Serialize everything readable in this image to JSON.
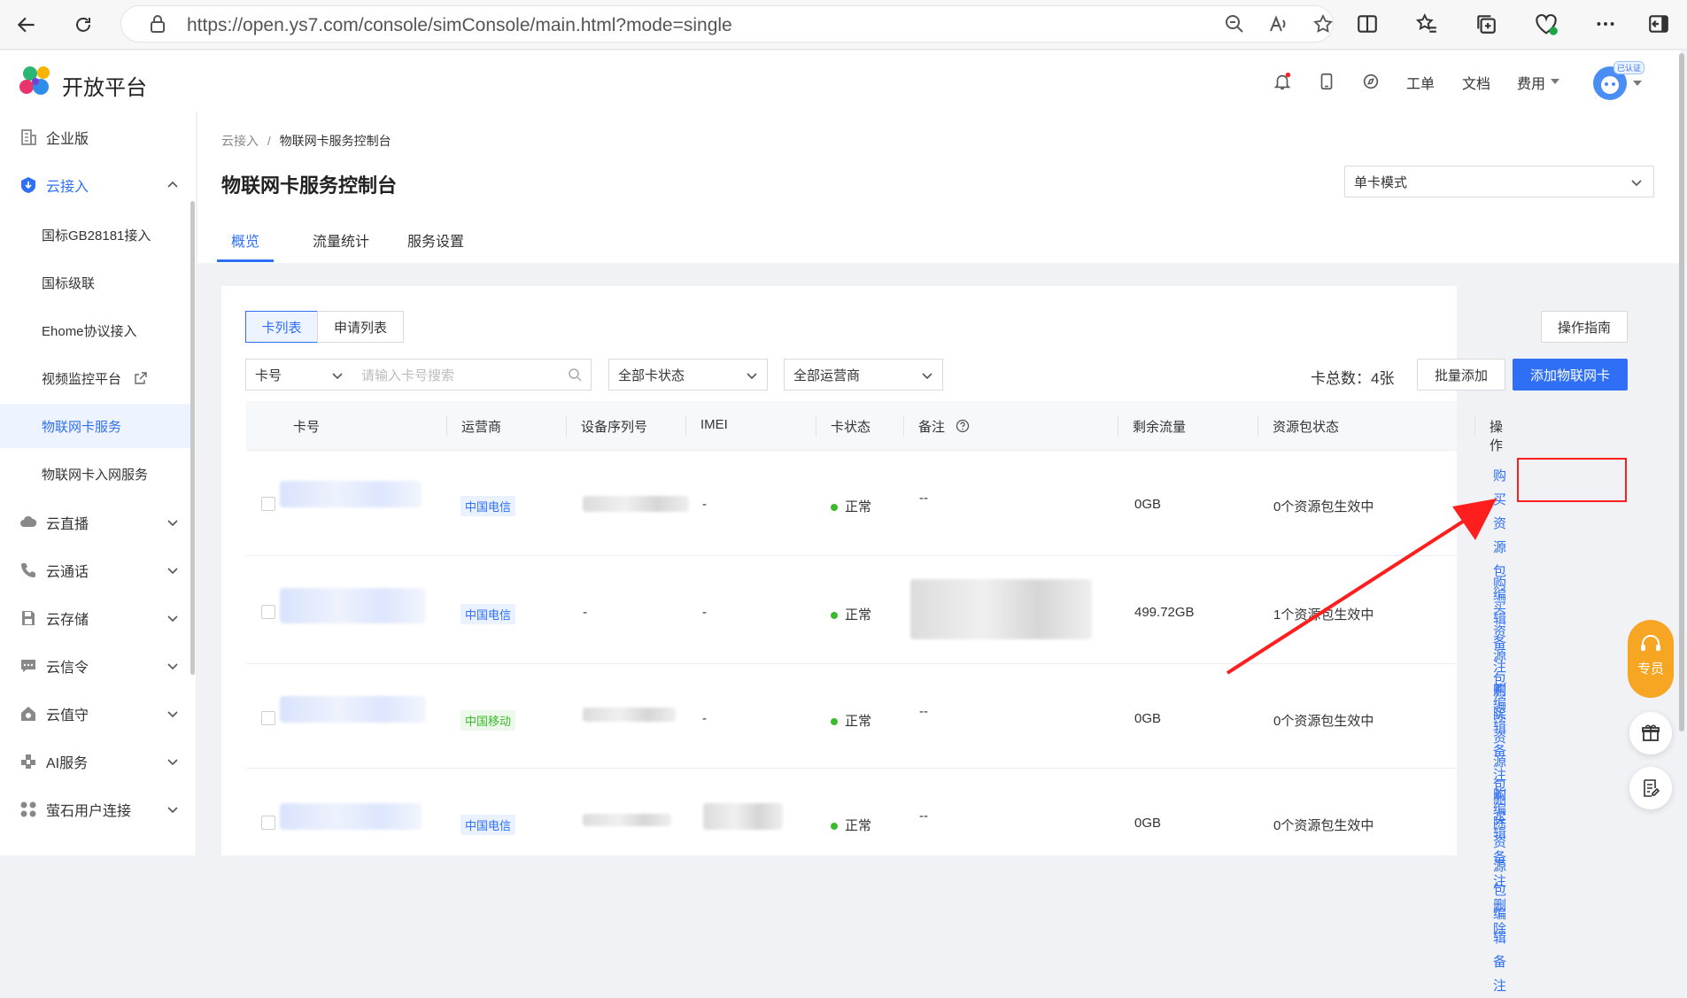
{
  "browser": {
    "url": "https://open.ys7.com/console/simConsole/main.html?mode=single"
  },
  "header": {
    "logo_text": "开放平台",
    "links": {
      "ticket": "工单",
      "docs": "文档",
      "fees": "费用"
    },
    "verified_badge": "已认证"
  },
  "sidebar": {
    "items": [
      {
        "label": "企业版",
        "icon": "building-icon"
      },
      {
        "label": "云接入",
        "icon": "cloud-access-icon"
      },
      {
        "label": "国标GB28181接入"
      },
      {
        "label": "国标级联"
      },
      {
        "label": "Ehome协议接入"
      },
      {
        "label": "视频监控平台"
      },
      {
        "label": "物联网卡服务"
      },
      {
        "label": "物联网卡入网服务"
      },
      {
        "label": "云直播",
        "icon": "cloud-icon"
      },
      {
        "label": "云通话",
        "icon": "phone-icon"
      },
      {
        "label": "云存储",
        "icon": "save-icon"
      },
      {
        "label": "云信令",
        "icon": "message-icon"
      },
      {
        "label": "云值守",
        "icon": "house-icon"
      },
      {
        "label": "AI服务",
        "icon": "puzzle-icon"
      },
      {
        "label": "萤石用户连接",
        "icon": "apps-icon"
      }
    ]
  },
  "page": {
    "breadcrumb_root": "云接入",
    "breadcrumb_sep": "/",
    "breadcrumb_current": "物联网卡服务控制台",
    "title": "物联网卡服务控制台",
    "mode": "单卡模式",
    "tabs": [
      "概览",
      "流量统计",
      "服务设置"
    ]
  },
  "toolbar": {
    "seg_cards": "卡列表",
    "seg_apply": "申请列表",
    "guide": "操作指南",
    "filter_field": "卡号",
    "search_placeholder": "请输入卡号搜索",
    "status_filter": "全部卡状态",
    "carrier_filter": "全部运营商",
    "total": "卡总数：4张",
    "batch_add": "批量添加",
    "add_card": "添加物联网卡"
  },
  "table": {
    "headers": [
      "卡号",
      "运营商",
      "设备序列号",
      "IMEI",
      "卡状态",
      "备注",
      "剩余流量",
      "资源包状态",
      "操作"
    ],
    "rows": [
      {
        "carrier": "中国电信",
        "serial": "",
        "imei": "-",
        "status": "正常",
        "note": "--",
        "traffic": "0GB",
        "pkg": "0个资源包生效中"
      },
      {
        "carrier": "中国电信",
        "serial": "-",
        "imei": "-",
        "status": "正常",
        "note": "",
        "traffic": "499.72GB",
        "pkg": "1个资源包生效中"
      },
      {
        "carrier": "中国移动",
        "serial": "",
        "imei": "-",
        "status": "正常",
        "note": "--",
        "traffic": "0GB",
        "pkg": "0个资源包生效中"
      },
      {
        "carrier": "中国电信",
        "serial": "",
        "imei": "",
        "status": "正常",
        "note": "--",
        "traffic": "0GB",
        "pkg": "0个资源包生效中"
      }
    ],
    "actions": {
      "buy": "购买资源包",
      "edit": "编辑备注",
      "delete": "删除"
    }
  },
  "float": {
    "service_label": "专员"
  },
  "colors": {
    "accent": "#2f6ff5",
    "ok": "#3cba2e",
    "annotation": "#ff1e1e",
    "float": "#f6a623"
  }
}
